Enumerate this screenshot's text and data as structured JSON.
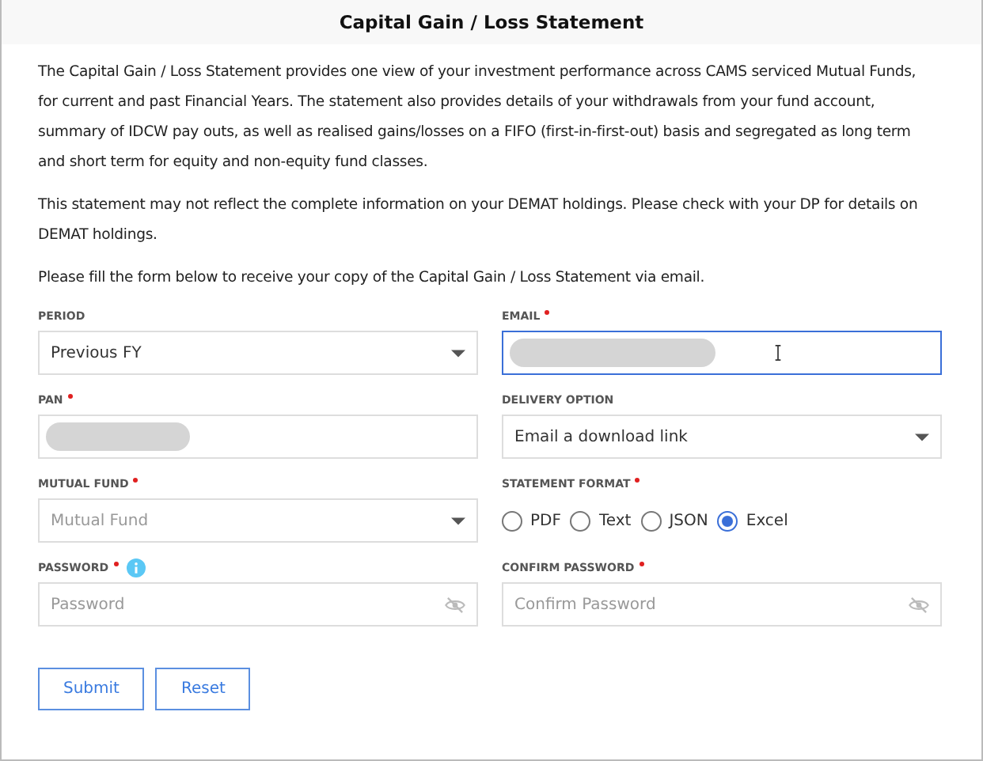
{
  "title": "Capital Gain / Loss Statement",
  "paragraphs": [
    "The Capital Gain / Loss Statement provides one view of your investment performance across CAMS serviced Mutual Funds, for current and past Financial Years. The statement also provides details of your withdrawals from your fund account, summary of IDCW pay outs, as well as realised gains/losses on a FIFO (first-in-first-out) basis and segregated as long term and short term for equity and non-equity fund classes.",
    "This statement may not reflect the complete information on your DEMAT holdings. Please check with your DP for details on DEMAT holdings.",
    "Please fill the form below to receive your copy of the Capital Gain / Loss Statement via email."
  ],
  "fields": [
    {
      "kind": "select",
      "label": "PERIOD",
      "required": false,
      "value": "Previous FY"
    },
    {
      "kind": "masked",
      "label": "EMAIL",
      "required": true,
      "focused": true
    },
    {
      "kind": "masked",
      "label": "PAN",
      "required": true,
      "focused": false
    },
    {
      "kind": "select",
      "label": "DELIVERY OPTION",
      "required": false,
      "value": "Email a download link"
    },
    {
      "kind": "select",
      "label": "MUTUAL FUND",
      "required": true,
      "placeholder": "Mutual Fund"
    },
    {
      "kind": "radio",
      "label": "STATEMENT FORMAT",
      "required": true,
      "options": [
        {
          "label": "PDF",
          "selected": false
        },
        {
          "label": "Text",
          "selected": false
        },
        {
          "label": "JSON",
          "selected": false
        },
        {
          "label": "Excel",
          "selected": true
        }
      ]
    },
    {
      "kind": "password",
      "label": "PASSWORD",
      "required": true,
      "info": true,
      "placeholder": "Password"
    },
    {
      "kind": "password",
      "label": "CONFIRM PASSWORD",
      "required": true,
      "info": false,
      "placeholder": "Confirm Password"
    }
  ],
  "buttons": [
    "Submit",
    "Reset"
  ]
}
